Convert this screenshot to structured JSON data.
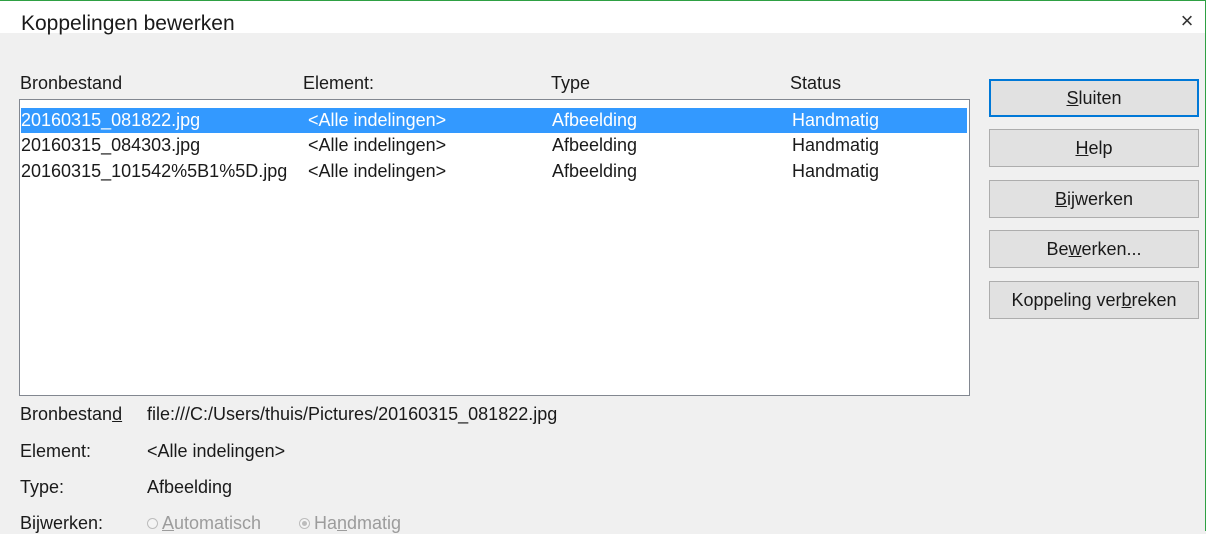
{
  "window": {
    "title": "Koppelingen bewerken",
    "close_glyph": "×"
  },
  "columns": [
    "Bronbestand",
    "Element:",
    "Type",
    "Status"
  ],
  "rows": [
    {
      "source": "20160315_081822.jpg",
      "element": "<Alle indelingen>",
      "type": "Afbeelding",
      "status": "Handmatig",
      "selected": true
    },
    {
      "source": "20160315_084303.jpg",
      "element": "<Alle indelingen>",
      "type": "Afbeelding",
      "status": "Handmatig",
      "selected": false
    },
    {
      "source": "20160315_101542%5B1%5D.jpg",
      "element": "<Alle indelingen>",
      "type": "Afbeelding",
      "status": "Handmatig",
      "selected": false
    }
  ],
  "buttons": {
    "close": {
      "pre": "",
      "mn": "S",
      "post": "luiten"
    },
    "help": {
      "pre": "",
      "mn": "H",
      "post": "elp"
    },
    "update": {
      "pre": "",
      "mn": "B",
      "post": "ijwerken"
    },
    "edit": {
      "pre": "Be",
      "mn": "w",
      "post": "erken..."
    },
    "break": {
      "pre": "Koppeling ver",
      "mn": "b",
      "post": "reken"
    }
  },
  "details": {
    "source_label": {
      "pre": "Bronbestan",
      "mn": "d",
      "post": ""
    },
    "source_value": "file:///C:/Users/thuis/Pictures/20160315_081822.jpg",
    "element_label": "Element:",
    "element_value": "<Alle indelingen>",
    "type_label": "Type:",
    "type_value": "Afbeelding",
    "update_label": "Bijwerken:",
    "auto": {
      "pre": "",
      "mn": "A",
      "post": "utomatisch"
    },
    "manual": {
      "pre": "Ha",
      "mn": "n",
      "post": "dmatig"
    }
  },
  "colors": {
    "selection": "#3399ff",
    "default_button_border": "#0078d7",
    "window_border": "#2ea043"
  }
}
